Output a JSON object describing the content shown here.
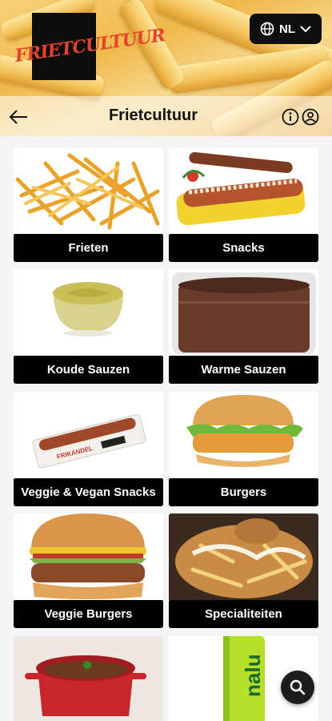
{
  "header": {
    "logo_text": "FRIETCULTUUR",
    "language_label": "NL",
    "title": "Frietcultuur"
  },
  "categories": [
    {
      "label": "Frieten",
      "image": "fries-image"
    },
    {
      "label": "Snacks",
      "image": "hotdog-snack-image"
    },
    {
      "label": "Koude Sauzen",
      "image": "cold-sauce-image"
    },
    {
      "label": "Warme Sauzen",
      "image": "warm-sauce-image"
    },
    {
      "label": "Veggie & Vegan Snacks",
      "image": "vegan-frikandel-image"
    },
    {
      "label": "Burgers",
      "image": "chicken-burger-image"
    },
    {
      "label": "Veggie Burgers",
      "image": "veggie-burger-image"
    },
    {
      "label": "Specialiteiten",
      "image": "loaded-fries-image"
    },
    {
      "label": "",
      "image": "stew-pot-image"
    },
    {
      "label": "",
      "image": "energy-drink-can-image"
    }
  ],
  "drink_can_text": "nalu",
  "snack_pack_text": "FRIKANDEL",
  "colors": {
    "accent_black": "#000000",
    "logo_red": "#e2442a",
    "background": "#f4f4f4"
  }
}
